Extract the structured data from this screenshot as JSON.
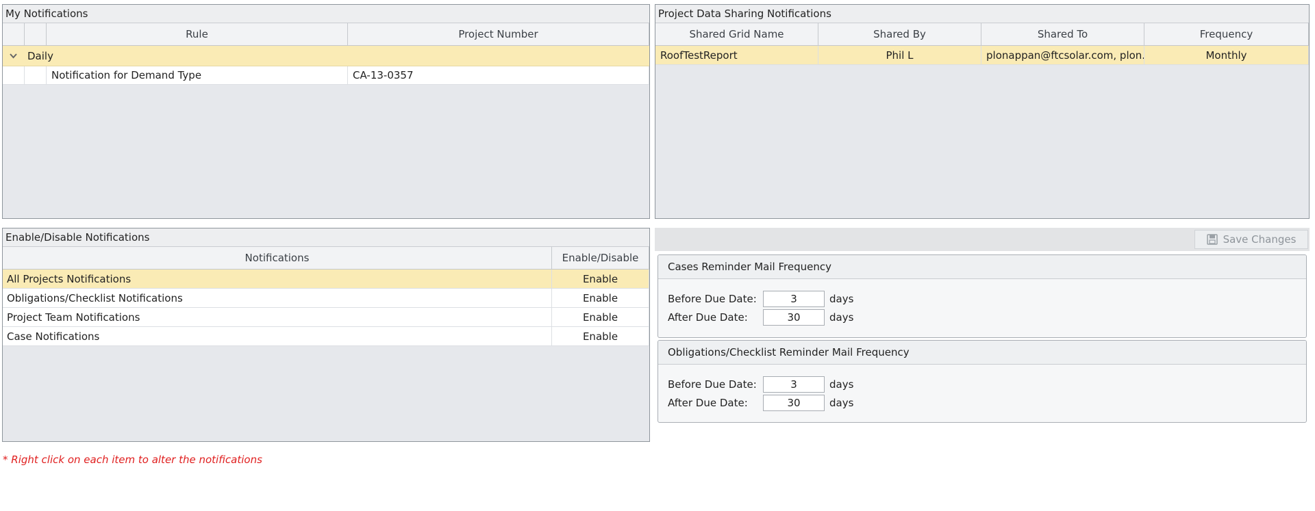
{
  "my_notifications": {
    "title": "My Notifications",
    "columns": [
      "Rule",
      "Project Number"
    ],
    "group": "Daily",
    "rows": [
      {
        "rule": "Notification for Demand Type",
        "project": "CA-13-0357"
      }
    ]
  },
  "sharing": {
    "title": "Project Data Sharing Notifications",
    "columns": [
      "Shared Grid Name",
      "Shared By",
      "Shared To",
      "Frequency"
    ],
    "rows": [
      {
        "grid": "RoofTestReport",
        "by": "Phil L",
        "to": "plonappan@ftcsolar.com, plon...",
        "freq": "Monthly"
      }
    ]
  },
  "enable_disable": {
    "title": "Enable/Disable Notifications",
    "columns": [
      "Notifications",
      "Enable/Disable"
    ],
    "rows": [
      {
        "name": "All Projects Notifications",
        "status": "Enable"
      },
      {
        "name": "Obligations/Checklist Notifications",
        "status": "Enable"
      },
      {
        "name": "Project Team Notifications",
        "status": "Enable"
      },
      {
        "name": "Case Notifications",
        "status": "Enable"
      }
    ]
  },
  "toolbar": {
    "save_label": "Save Changes"
  },
  "cases_reminder": {
    "title": "Cases Reminder Mail Frequency",
    "before_label": "Before Due Date:",
    "before_value": "3",
    "after_label": "After Due Date:",
    "after_value": "30",
    "unit": "days"
  },
  "obligations_reminder": {
    "title": "Obligations/Checklist Reminder Mail Frequency",
    "before_label": "Before Due Date:",
    "before_value": "3",
    "after_label": "After Due Date:",
    "after_value": "30",
    "unit": "days"
  },
  "footnote": "* Right click on each item to alter the notifications",
  "colors": {
    "selected_row": "#faebb5",
    "footnote": "#e01e1e",
    "panel_bg": "#e6e8ec"
  }
}
